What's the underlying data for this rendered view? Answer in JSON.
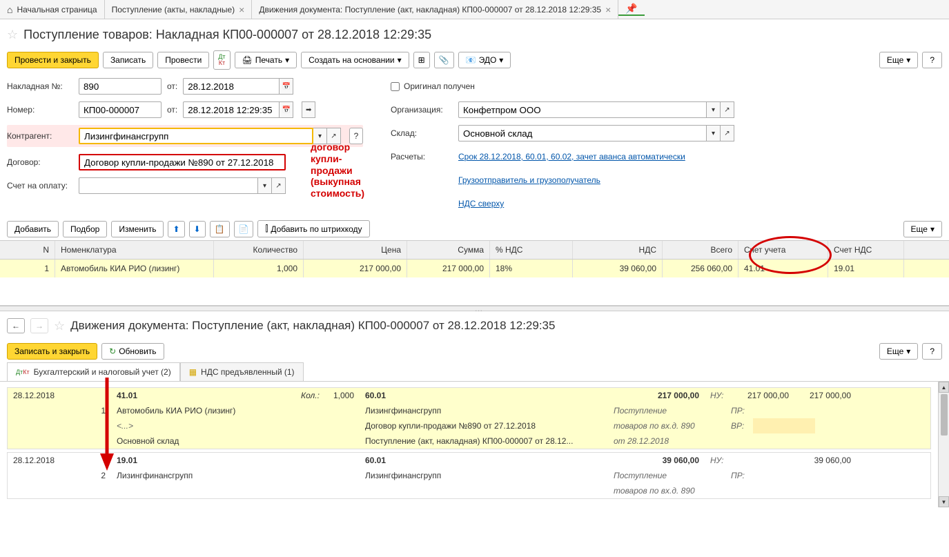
{
  "tabs": {
    "home": "Начальная страница",
    "t1": "Поступление (акты, накладные)",
    "t2": "Движения документа: Поступление (акт, накладная) КП00-000007 от 28.12.2018 12:29:35"
  },
  "doc": {
    "title": "Поступление товаров: Накладная КП00-000007 от 28.12.2018 12:29:35"
  },
  "toolbar": {
    "post_close": "Провести и закрыть",
    "write": "Записать",
    "post": "Провести",
    "print": "Печать",
    "create_based": "Создать на основании",
    "edo": "ЭДО",
    "more": "Еще",
    "q": "?"
  },
  "form": {
    "invoice_no_label": "Накладная №:",
    "invoice_no": "890",
    "from_label": "от:",
    "invoice_date": "28.12.2018",
    "number_label": "Номер:",
    "number": "КП00-000007",
    "number_date": "28.12.2018 12:29:35",
    "contractor_label": "Контрагент:",
    "contractor": "Лизингфинансгрупп",
    "contract_label": "Договор:",
    "contract": "Договор купли-продажи №890 от 27.12.2018",
    "payment_invoice_label": "Счет на оплату:",
    "original_received": "Оригинал получен",
    "org_label": "Организация:",
    "org": "Конфетпром ООО",
    "warehouse_label": "Склад:",
    "warehouse": "Основной склад",
    "settlements_label": "Расчеты:",
    "settlements_link": "Срок 28.12.2018, 60.01, 60.02, зачет аванса автоматически",
    "consignor_link": "Грузоотправитель и грузополучатель",
    "vat_link": "НДС сверху"
  },
  "annotation": {
    "line1": "договор купли-",
    "line2": "продажи (выкупная",
    "line3": "стоимость)"
  },
  "table_toolbar": {
    "add": "Добавить",
    "pick": "Подбор",
    "edit": "Изменить",
    "barcode": "Добавить по штрихкоду",
    "more": "Еще"
  },
  "grid": {
    "headers": {
      "n": "N",
      "nom": "Номенклатура",
      "qty": "Количество",
      "price": "Цена",
      "sum": "Сумма",
      "vat": "% НДС",
      "vatamt": "НДС",
      "total": "Всего",
      "acct": "Счет учета",
      "vatacct": "Счет НДС"
    },
    "row": {
      "n": "1",
      "nom": "Автомобиль КИА РИО (лизинг)",
      "qty": "1,000",
      "price": "217 000,00",
      "sum": "217 000,00",
      "vat": "18%",
      "vatamt": "39 060,00",
      "total": "256 060,00",
      "acct": "41.01",
      "vatacct": "19.01"
    }
  },
  "lower": {
    "title": "Движения документа: Поступление (акт, накладная) КП00-000007 от 28.12.2018 12:29:35",
    "write_close": "Записать и закрыть",
    "refresh": "Обновить",
    "more": "Еще",
    "q": "?",
    "tab1": "Бухгалтерский и налоговый учет (2)",
    "tab2": "НДС предъявленный (1)"
  },
  "entries": {
    "e1": {
      "date": "28.12.2018",
      "n": "1",
      "dt_acct": "41.01",
      "qty_label": "Кол.:",
      "qty": "1,000",
      "ct_acct": "60.01",
      "amt": "217 000,00",
      "nu": "НУ:",
      "nu_dt": "217 000,00",
      "nu_ct": "217 000,00",
      "sub1": "Автомобиль КИА РИО (лизинг)",
      "ct_sub1": "Лизингфинансгрупп",
      "op1": "Поступление",
      "pr": "ПР:",
      "sub2": "<...>",
      "ct_sub2": "Договор купли-продажи №890 от 27.12.2018",
      "op2": "товаров по вх.д. 890",
      "vr": "ВР:",
      "sub3": "Основной склад",
      "ct_sub3": "Поступление (акт, накладная) КП00-000007 от 28.12...",
      "op3": "от 28.12.2018"
    },
    "e2": {
      "date": "28.12.2018",
      "n": "2",
      "dt_acct": "19.01",
      "ct_acct": "60.01",
      "amt": "39 060,00",
      "nu": "НУ:",
      "nu_ct": "39 060,00",
      "sub1": "Лизингфинансгрупп",
      "ct_sub1": "Лизингфинансгрупп",
      "op1": "Поступление",
      "pr": "ПР:",
      "op2": "товаров по вх.д. 890"
    }
  }
}
